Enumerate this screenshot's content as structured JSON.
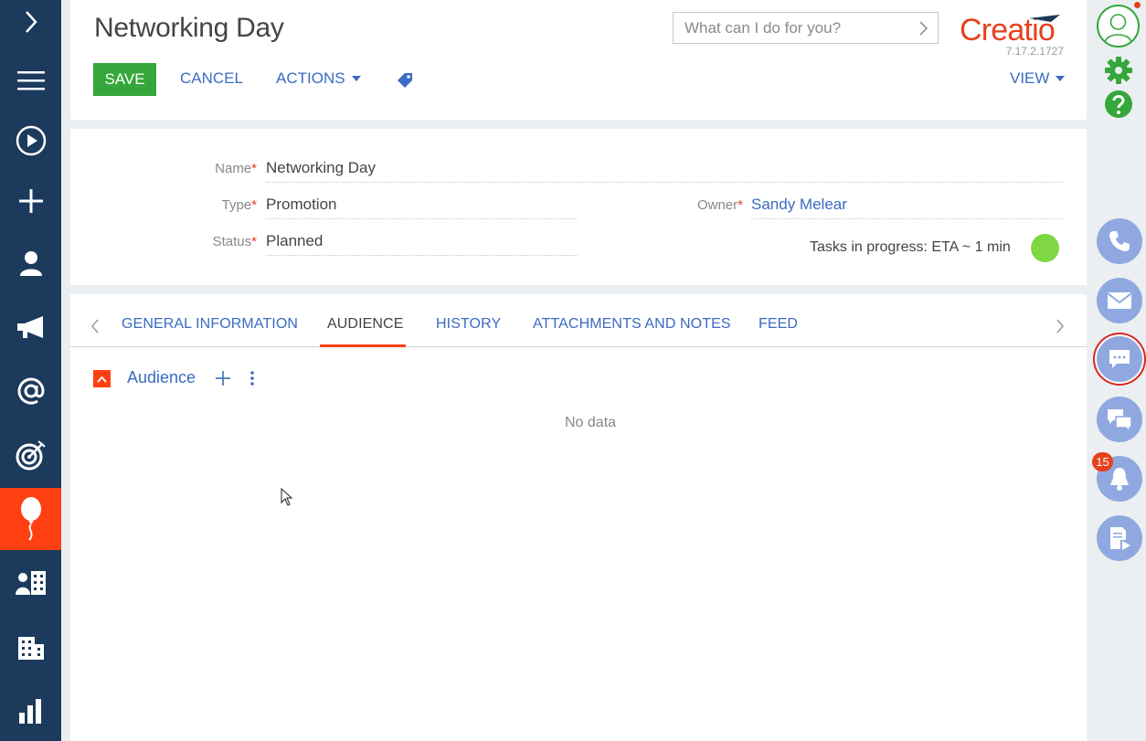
{
  "left_nav": {
    "items": [
      {
        "name": "expand",
        "icon": "chevron-right-icon"
      },
      {
        "name": "menu",
        "icon": "hamburger-icon"
      },
      {
        "name": "processes",
        "icon": "play-circle-icon"
      },
      {
        "name": "add",
        "icon": "plus-icon"
      },
      {
        "name": "contacts",
        "icon": "person-icon"
      },
      {
        "name": "campaigns",
        "icon": "megaphone-icon"
      },
      {
        "name": "email",
        "icon": "at-icon"
      },
      {
        "name": "leads",
        "icon": "target-icon"
      },
      {
        "name": "events",
        "icon": "balloon-icon",
        "active": true
      },
      {
        "name": "accounts",
        "icon": "contact-building-icon"
      },
      {
        "name": "companies",
        "icon": "building-icon"
      },
      {
        "name": "analytics",
        "icon": "bar-chart-icon"
      }
    ],
    "active_color": "#ff4013",
    "background": "#1b3a5c"
  },
  "header": {
    "title": "Networking Day",
    "search_placeholder": "What can I do for you?",
    "logo_text": "Creatio",
    "version": "7.17.2.1727",
    "save_label": "SAVE",
    "cancel_label": "CANCEL",
    "actions_label": "ACTIONS",
    "view_label": "VIEW"
  },
  "fields": {
    "name_label": "Name",
    "name_value": "Networking Day",
    "type_label": "Type",
    "type_value": "Promotion",
    "status_label": "Status",
    "status_value": "Planned",
    "owner_label": "Owner",
    "owner_value": "Sandy Melear",
    "required_mark": "*",
    "tasks_text": "Tasks in progress: ETA ~ 1 min"
  },
  "tabs": {
    "items": [
      "GENERAL INFORMATION",
      "AUDIENCE",
      "HISTORY",
      "ATTACHMENTS AND NOTES",
      "FEED"
    ],
    "active": "AUDIENCE"
  },
  "detail": {
    "title": "Audience",
    "empty_text": "No data"
  },
  "right_panel": {
    "notification_count": "15",
    "buttons": [
      "phone-icon",
      "envelope-icon",
      "chat-icon",
      "conversations-icon",
      "bell-icon",
      "document-play-icon"
    ]
  },
  "colors": {
    "accent": "#ff4013",
    "save_green": "#35a73b",
    "link_blue": "#3b6bc2",
    "status_green": "#7ed743",
    "panel_button": "#8fa9e0"
  }
}
